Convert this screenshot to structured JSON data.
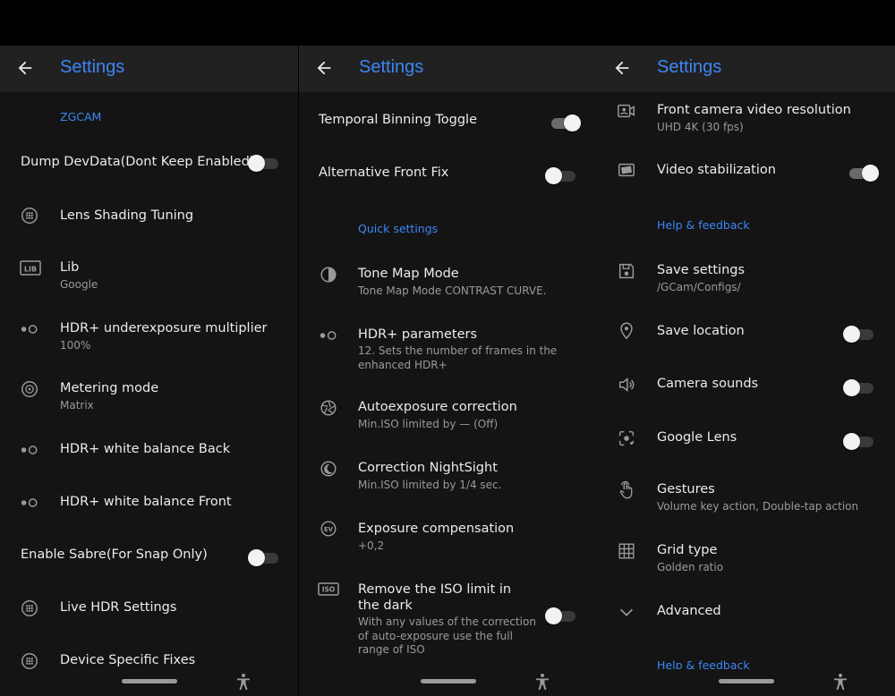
{
  "screen_title": "Settings",
  "panel1": {
    "category": "ZGCAM",
    "dump": {
      "title": "Dump DevData(Dont Keep Enabled)",
      "on": false
    },
    "lens": {
      "title": "Lens Shading Tuning"
    },
    "lib": {
      "title": "Lib",
      "subtitle": "Google",
      "icon_text": "LIB"
    },
    "under": {
      "title": "HDR+ underexposure multiplier",
      "subtitle": "100%"
    },
    "meter": {
      "title": "Metering mode",
      "subtitle": "Matrix"
    },
    "wbback": {
      "title": "HDR+ white balance Back"
    },
    "wbfront": {
      "title": "HDR+ white balance Front"
    },
    "sabre": {
      "title": "Enable Sabre(For Snap Only)",
      "on": false
    },
    "livehdr": {
      "title": "Live HDR Settings"
    },
    "device": {
      "title": "Device Specific Fixes"
    }
  },
  "panel2": {
    "binning": {
      "title": "Temporal Binning Toggle",
      "on": true
    },
    "altfront": {
      "title": "Alternative Front Fix",
      "on": false
    },
    "category": "Quick settings",
    "tonemap": {
      "title": "Tone Map Mode",
      "subtitle": "Tone Map Mode CONTRAST CURVE."
    },
    "hdrparams": {
      "title": "HDR+ parameters",
      "subtitle": "12. Sets the number of frames in the enhanced HDR+"
    },
    "autoexp": {
      "title": "Autoexposure correction",
      "subtitle": "Min.ISO limited by — (Off)"
    },
    "night": {
      "title": "Correction NightSight",
      "subtitle": "Min.ISO limited by 1/4 sec."
    },
    "expcomp": {
      "title": "Exposure compensation",
      "subtitle": "+0,2",
      "icon_text": "EV"
    },
    "iso": {
      "title": "Remove the ISO limit in the dark",
      "subtitle": "With any values of the correction of auto-exposure use the full range of ISO",
      "icon_text": "ISO",
      "on": false
    }
  },
  "panel3": {
    "frontvideo": {
      "title": "Front camera video resolution",
      "subtitle": "UHD 4K (30 fps)"
    },
    "stab": {
      "title": "Video stabilization",
      "on": true
    },
    "category": "Help & feedback",
    "save": {
      "title": "Save settings",
      "subtitle": "/GCam/Configs/"
    },
    "location": {
      "title": "Save location",
      "on": false
    },
    "sounds": {
      "title": "Camera sounds",
      "on": false
    },
    "lens": {
      "title": "Google Lens",
      "on": false
    },
    "gestures": {
      "title": "Gestures",
      "subtitle": "Volume key action, Double-tap action"
    },
    "grid": {
      "title": "Grid type",
      "subtitle": "Golden ratio"
    },
    "advanced": {
      "title": "Advanced"
    },
    "category2": "Help & feedback"
  },
  "colors": {
    "accent": "#3d86f5",
    "background": "#141414",
    "appbar": "#212121",
    "text": "#ececec",
    "secondary": "#9a9a9a"
  },
  "icons": [
    "back-arrow-icon",
    "grid-dots-icon",
    "lib-badge-icon",
    "dual-dot-icon",
    "metering-icon",
    "contrast-icon",
    "aperture-icon",
    "moon-icon",
    "ev-badge-icon",
    "iso-badge-icon",
    "video-camera-icon",
    "stabilization-icon",
    "save-icon",
    "location-pin-icon",
    "speaker-icon",
    "google-lens-icon",
    "touch-gesture-icon",
    "grid-icon",
    "chevron-down-icon",
    "accessibility-icon"
  ]
}
